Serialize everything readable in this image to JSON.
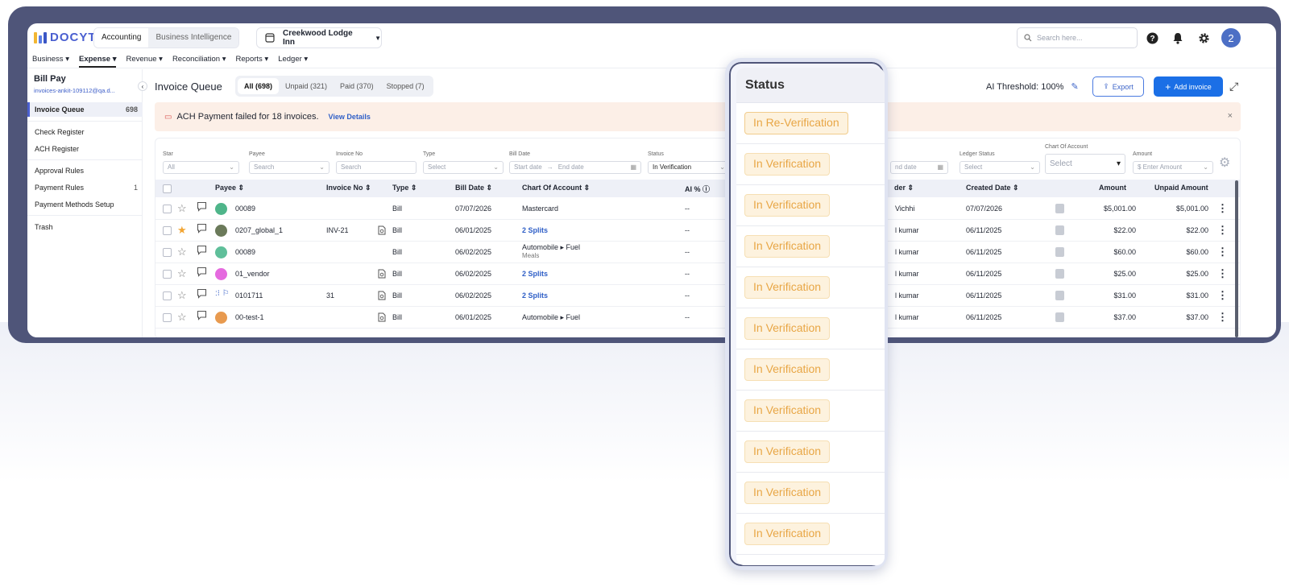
{
  "app": {
    "logo": "DOCYT",
    "modes": [
      "Accounting",
      "Business Intelligence"
    ],
    "business": "Creekwood Lodge Inn",
    "search_placeholder": "Search here...",
    "avatar": "2"
  },
  "nav": [
    "Business",
    "Expense",
    "Revenue",
    "Reconciliation",
    "Reports",
    "Ledger"
  ],
  "sidebar": {
    "title": "Bill Pay",
    "email": "invoices-ankit-109112@qa.d...",
    "items": [
      {
        "label": "Invoice Queue",
        "count": "698"
      },
      {
        "label": "Check Register",
        "count": ""
      },
      {
        "label": "ACH Register",
        "count": ""
      },
      {
        "label": "Approval Rules",
        "count": ""
      },
      {
        "label": "Payment Rules",
        "count": "1"
      },
      {
        "label": "Payment Methods Setup",
        "count": ""
      },
      {
        "label": "Trash",
        "count": ""
      }
    ]
  },
  "main": {
    "title": "Invoice Queue",
    "tabs": [
      "All (698)",
      "Unpaid (321)",
      "Paid (370)",
      "Stopped (7)"
    ],
    "ai_threshold": "AI Threshold: 100%",
    "export_label": "Export",
    "add_label": "Add invoice",
    "alert": {
      "text": "ACH Payment failed for 18 invoices.",
      "link": "View Details"
    }
  },
  "filters": {
    "star": {
      "label": "Star",
      "value": "All"
    },
    "payee": {
      "label": "Payee",
      "placeholder": "Search"
    },
    "invoice_no": {
      "label": "Invoice No",
      "placeholder": "Search"
    },
    "type": {
      "label": "Type",
      "placeholder": "Select"
    },
    "bill_date": {
      "label": "Bill Date",
      "start": "Start date",
      "end": "End date"
    },
    "status": {
      "label": "Status",
      "value": "In Verification"
    },
    "end_date2": "nd date",
    "ledger_status": {
      "label": "Ledger Status",
      "placeholder": "Select"
    },
    "chart_of_account": {
      "label": "Chart Of Account",
      "placeholder": "Select"
    },
    "amount": {
      "label": "Amount",
      "placeholder": "$ Enter Amount"
    }
  },
  "columns": {
    "payee": "Payee",
    "invoice_no": "Invoice No",
    "type": "Type",
    "bill_date": "Bill Date",
    "chart": "Chart Of Account",
    "ai": "AI %",
    "uploader": "der",
    "created": "Created Date",
    "amount": "Amount",
    "unpaid": "Unpaid Amount"
  },
  "rows": [
    {
      "starred": false,
      "avatar_color": "#4fb58a",
      "payee": "00089",
      "invoice_no": "",
      "doc": false,
      "type": "Bill",
      "bill_date": "07/07/2026",
      "chart": "Mastercard",
      "chart_sub": "",
      "split": false,
      "ai": "--",
      "uploader": "Vichhi",
      "created": "07/07/2026",
      "amount": "$5,001.00",
      "unpaid": "$5,001.00"
    },
    {
      "starred": true,
      "avatar_color": "#6b7a5a",
      "payee": "0207_global_1",
      "invoice_no": "INV-21",
      "doc": true,
      "type": "Bill",
      "bill_date": "06/01/2025",
      "chart": "2 Splits",
      "chart_sub": "",
      "split": true,
      "ai": "--",
      "uploader": "l kumar",
      "created": "06/11/2025",
      "amount": "$22.00",
      "unpaid": "$22.00"
    },
    {
      "starred": false,
      "avatar_color": "#5fbf9a",
      "payee": "00089",
      "invoice_no": "",
      "doc": false,
      "type": "Bill",
      "bill_date": "06/02/2025",
      "chart": "Automobile ▸ Fuel",
      "chart_sub": "Meals",
      "split": false,
      "ai": "--",
      "uploader": "l kumar",
      "created": "06/11/2025",
      "amount": "$60.00",
      "unpaid": "$60.00"
    },
    {
      "starred": false,
      "avatar_color": "#e56adf",
      "payee": "01_vendor",
      "invoice_no": "",
      "doc": true,
      "type": "Bill",
      "bill_date": "06/02/2025",
      "chart": "2 Splits",
      "chart_sub": "",
      "split": true,
      "ai": "--",
      "uploader": "l kumar",
      "created": "06/11/2025",
      "amount": "$25.00",
      "unpaid": "$25.00"
    },
    {
      "starred": false,
      "avatar_color": "",
      "payee": "0101711",
      "invoice_no": "31",
      "doc": true,
      "type": "Bill",
      "bill_date": "06/02/2025",
      "chart": "2 Splits",
      "chart_sub": "",
      "split": true,
      "ai": "--",
      "uploader": "l kumar",
      "created": "06/11/2025",
      "amount": "$31.00",
      "unpaid": "$31.00"
    },
    {
      "starred": false,
      "avatar_color": "#e89a4f",
      "payee": "00-test-1",
      "invoice_no": "",
      "doc": true,
      "type": "Bill",
      "bill_date": "06/01/2025",
      "chart": "Automobile ▸ Fuel",
      "chart_sub": "",
      "split": false,
      "ai": "--",
      "uploader": "l kumar",
      "created": "06/11/2025",
      "amount": "$37.00",
      "unpaid": "$37.00"
    }
  ],
  "status_panel": {
    "title": "Status",
    "items": [
      "In Re-Verification",
      "In Verification",
      "In Verification",
      "In Verification",
      "In Verification",
      "In Verification",
      "In Verification",
      "In Verification",
      "In Verification",
      "In Verification",
      "In Verification"
    ]
  }
}
